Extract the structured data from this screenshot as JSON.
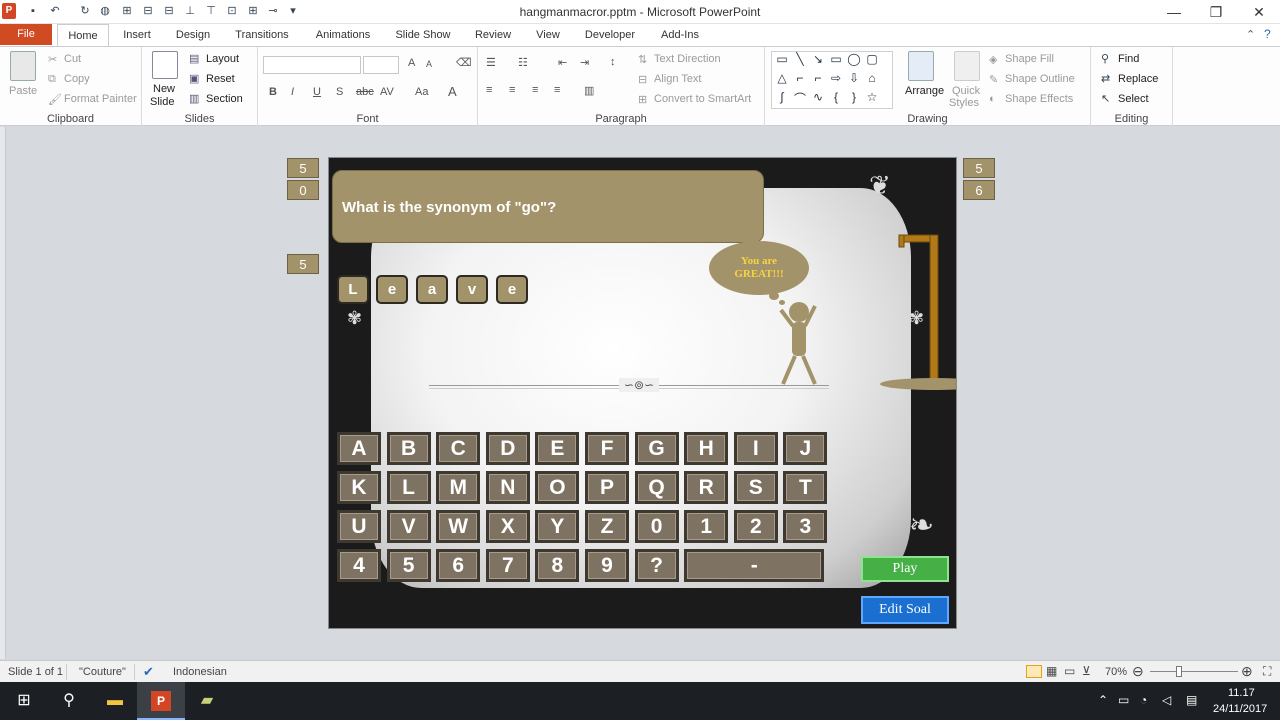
{
  "window": {
    "title": "hangmanmacror.pptm - Microsoft PowerPoint",
    "minimize": "—",
    "restore": "❐",
    "close": "✕"
  },
  "tabs": [
    "File",
    "Home",
    "Insert",
    "Design",
    "Transitions",
    "Animations",
    "Slide Show",
    "Review",
    "View",
    "Developer",
    "Add-Ins"
  ],
  "ribbon": {
    "clipboard": {
      "label": "Clipboard",
      "paste": "Paste",
      "cut": "Cut",
      "copy": "Copy",
      "format_painter": "Format Painter"
    },
    "slides": {
      "label": "Slides",
      "new_slide_1": "New",
      "new_slide_2": "Slide",
      "layout": "Layout",
      "reset": "Reset",
      "section": "Section"
    },
    "font": {
      "label": "Font",
      "bold": "B",
      "italic": "I",
      "underline": "U",
      "shadow": "S",
      "strike": "abc",
      "spacing": "AV",
      "case": "Aa",
      "color": "A",
      "grow": "A",
      "shrink": "A"
    },
    "paragraph": {
      "label": "Paragraph",
      "text_direction": "Text Direction",
      "align_text": "Align Text",
      "smartart": "Convert to SmartArt"
    },
    "drawing": {
      "label": "Drawing",
      "arrange": "Arrange",
      "quick_styles_1": "Quick",
      "quick_styles_2": "Styles",
      "shape_fill": "Shape Fill",
      "shape_outline": "Shape Outline",
      "shape_effects": "Shape Effects"
    },
    "editing": {
      "label": "Editing",
      "find": "Find",
      "replace": "Replace",
      "select": "Select"
    }
  },
  "slide": {
    "question": "What is the synonym of \"go\"?",
    "answer_letters": [
      "L",
      "e",
      "a",
      "v",
      "e"
    ],
    "cloud_text_1": "You are",
    "cloud_text_2": "GREAT!!!",
    "keyboard_rows": [
      [
        "A",
        "B",
        "C",
        "D",
        "E",
        "F",
        "G",
        "H",
        "I",
        "J"
      ],
      [
        "K",
        "L",
        "M",
        "N",
        "O",
        "P",
        "Q",
        "R",
        "S",
        "T"
      ],
      [
        "U",
        "V",
        "W",
        "X",
        "Y",
        "Z",
        "0",
        "1",
        "2",
        "3"
      ],
      [
        "4",
        "5",
        "6",
        "7",
        "8",
        "9",
        "?"
      ]
    ],
    "dash_key": "-",
    "play_button": "Play",
    "edit_button": "Edit Soal",
    "divider_ornament": "∽⊚∽"
  },
  "counters": {
    "left": [
      "5",
      "0",
      "5"
    ],
    "right": [
      "5",
      "6"
    ]
  },
  "statusbar": {
    "slide": "Slide 1 of 1",
    "theme": "\"Couture\"",
    "language": "Indonesian",
    "zoom": "70%"
  },
  "taskbar": {
    "time": "11.17",
    "date": "24/11/2017"
  }
}
